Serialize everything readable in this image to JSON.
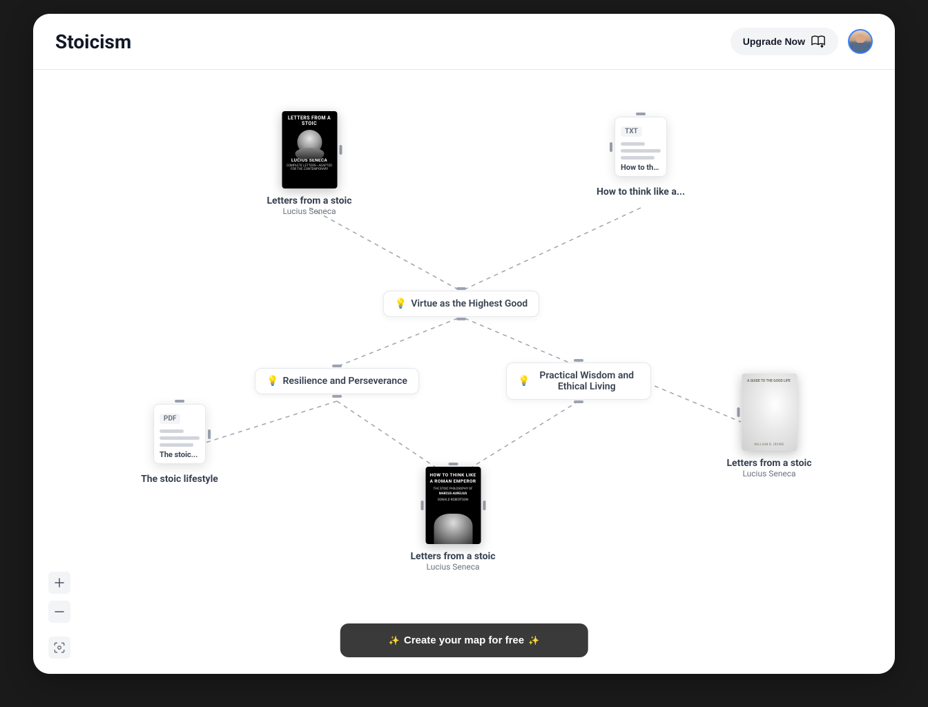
{
  "header": {
    "title": "Stoicism",
    "upgrade_label": "Upgrade Now"
  },
  "cta_label": "Create your map for free",
  "concepts": {
    "virtue": "Virtue as the Highest Good",
    "resilience": "Resilience and Perseverance",
    "practical": "Practical Wisdom and Ethical Living"
  },
  "items": {
    "letters_top": {
      "title": "Letters from a stoic",
      "author": "Lucius Seneca",
      "cover_title": "LETTERS FROM A STOIC",
      "cover_author": "LUCIUS SENECA"
    },
    "how_to_think": {
      "badge": "TXT",
      "card_title": "How to thi...",
      "title": "How to think like a..."
    },
    "stoic_lifestyle": {
      "badge": "PDF",
      "card_title": "The stoic...",
      "title": "The stoic lifestyle"
    },
    "roman_emperor": {
      "title": "Letters from a stoic",
      "author": "Lucius Seneca",
      "cover_title": "HOW TO THINK LIKE A ROMAN EMPEROR",
      "cover_sub": "THE STOIC PHILOSOPHY OF",
      "cover_author": "MARCUS AURELIUS",
      "cover_byline": "DONALD ROBERTSON"
    },
    "letters_right": {
      "title": "Letters from a stoic",
      "author": "Lucius Seneca",
      "cover_text": "A GUIDE TO THE GOOD LIFE",
      "cover_byline": "WILLIAM B. IRVINE"
    }
  },
  "icons": {
    "bulb": "💡",
    "sparkle": "✨"
  }
}
